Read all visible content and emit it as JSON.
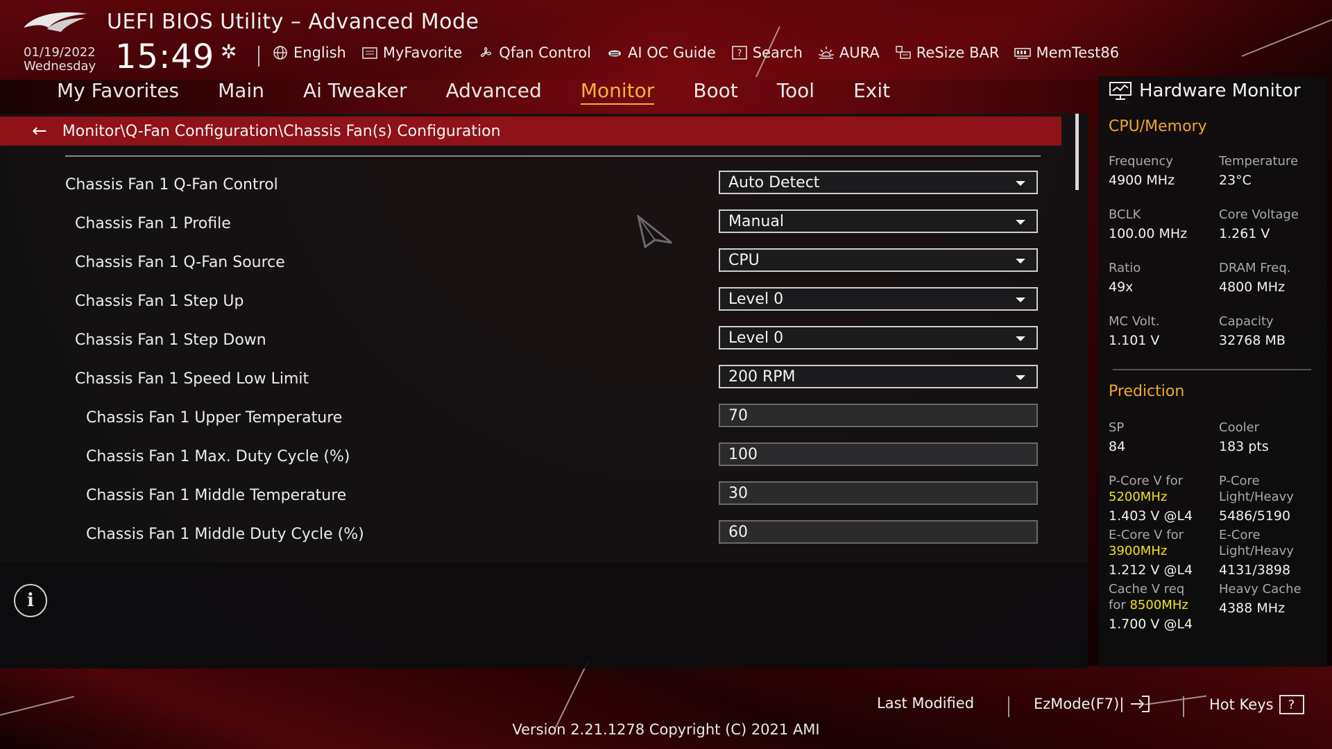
{
  "header": {
    "title": "UEFI BIOS Utility – Advanced Mode",
    "date": "01/19/2022",
    "weekday": "Wednesday",
    "time": "15:49"
  },
  "toolbar": [
    {
      "label": "English",
      "icon": "globe-icon"
    },
    {
      "label": "MyFavorite",
      "icon": "favorite-icon"
    },
    {
      "label": "Qfan Control",
      "icon": "fan-icon"
    },
    {
      "label": "AI OC Guide",
      "icon": "ai-oc-icon"
    },
    {
      "label": "Search",
      "icon": "search-help-icon"
    },
    {
      "label": "AURA",
      "icon": "aura-icon"
    },
    {
      "label": "ReSize BAR",
      "icon": "resize-bar-icon"
    },
    {
      "label": "MemTest86",
      "icon": "memtest-icon"
    }
  ],
  "menu": {
    "items": [
      "My Favorites",
      "Main",
      "Ai Tweaker",
      "Advanced",
      "Monitor",
      "Boot",
      "Tool",
      "Exit"
    ],
    "active": "Monitor"
  },
  "breadcrumb": "Monitor\\Q-Fan Configuration\\Chassis Fan(s) Configuration",
  "settings": [
    {
      "label": "Chassis Fan 1 Q-Fan Control",
      "value": "Auto Detect",
      "type": "select",
      "indent": 0
    },
    {
      "label": "Chassis Fan 1 Profile",
      "value": "Manual",
      "type": "select",
      "indent": 1
    },
    {
      "label": "Chassis Fan 1 Q-Fan Source",
      "value": "CPU",
      "type": "select",
      "indent": 1
    },
    {
      "label": "Chassis Fan 1 Step Up",
      "value": "Level 0",
      "type": "select",
      "indent": 1
    },
    {
      "label": "Chassis Fan 1 Step Down",
      "value": "Level 0",
      "type": "select",
      "indent": 1
    },
    {
      "label": "Chassis Fan 1 Speed Low Limit",
      "value": "200 RPM",
      "type": "select",
      "indent": 1
    },
    {
      "label": "Chassis Fan 1 Upper Temperature",
      "value": "70",
      "type": "text",
      "indent": 2
    },
    {
      "label": "Chassis Fan 1 Max. Duty Cycle (%)",
      "value": "100",
      "type": "text",
      "indent": 2
    },
    {
      "label": "Chassis Fan 1 Middle Temperature",
      "value": "30",
      "type": "text",
      "indent": 2
    },
    {
      "label": "Chassis Fan 1 Middle Duty Cycle (%)",
      "value": "60",
      "type": "text",
      "indent": 2
    }
  ],
  "hardware_monitor": {
    "title": "Hardware Monitor",
    "cpu_memory_title": "CPU/Memory",
    "frequency_label": "Frequency",
    "frequency": "4900 MHz",
    "temperature_label": "Temperature",
    "temperature": "23°C",
    "bclk_label": "BCLK",
    "bclk": "100.00 MHz",
    "core_voltage_label": "Core Voltage",
    "core_voltage": "1.261 V",
    "ratio_label": "Ratio",
    "ratio": "49x",
    "dram_freq_label": "DRAM Freq.",
    "dram_freq": "4800 MHz",
    "mc_volt_label": "MC Volt.",
    "mc_volt": "1.101 V",
    "capacity_label": "Capacity",
    "capacity": "32768 MB",
    "prediction_title": "Prediction",
    "sp_label": "SP",
    "sp": "84",
    "cooler_label": "Cooler",
    "cooler": "183 pts",
    "pcore_v_label": "P-Core V for",
    "pcore_v_freq": "5200MHz",
    "pcore_v": "1.403 V @L4",
    "pcore_lh_label1": "P-Core",
    "pcore_lh_label2": "Light/Heavy",
    "pcore_lh": "5486/5190",
    "ecore_v_label": "E-Core V for",
    "ecore_v_freq": "3900MHz",
    "ecore_v": "1.212 V @L4",
    "ecore_lh_label1": "E-Core",
    "ecore_lh_label2": "Light/Heavy",
    "ecore_lh": "4131/3898",
    "cache_v_label1": "Cache V req",
    "cache_v_label2": "for",
    "cache_v_freq": "8500MHz",
    "cache_v": "1.700 V @L4",
    "heavy_cache_label": "Heavy Cache",
    "heavy_cache": "4388 MHz"
  },
  "footer": {
    "last_modified": "Last Modified",
    "ezmode": "EzMode(F7)|",
    "hotkeys": "Hot Keys",
    "hotkeys_glyph": "?",
    "version": "Version 2.21.1278 Copyright (C) 2021 AMI"
  },
  "colors": {
    "accent": "#f4b43a",
    "breadcrumb_bg": "#8e1217",
    "prediction_highlight": "#f2e21c"
  }
}
